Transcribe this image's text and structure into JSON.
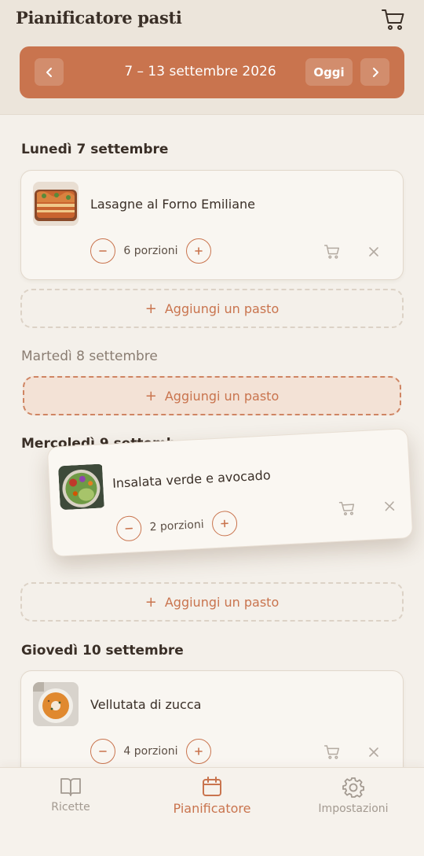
{
  "header": {
    "title": "Pianificatore pasti",
    "cart_icon": "shopping-cart-icon"
  },
  "week_nav": {
    "prev_icon": "chevron-left-icon",
    "range": "7 – 13 settembre 2026",
    "today_label": "Oggi",
    "next_icon": "chevron-right-icon"
  },
  "days": [
    {
      "title": "Lunedì 7 settembre",
      "meals": [
        {
          "name": "Lasagne al Forno Emiliane",
          "portions": "6 porzioni"
        }
      ],
      "add_label": "Aggiungi un pasto"
    },
    {
      "title": "Martedì 8 settembre",
      "meals": [],
      "add_label": "Aggiungi un pasto"
    },
    {
      "title": "Mercoledì 9 settembre",
      "meals": [],
      "add_label": "Aggiungi un pasto"
    },
    {
      "title": "Giovedì 10 settembre",
      "meals": [
        {
          "name": "Vellutata di zucca",
          "portions": "4 porzioni"
        }
      ],
      "add_label": "Aggiungi un pasto"
    }
  ],
  "dragged_meal": {
    "name": "Insalata verde e avocado",
    "portions": "2 porzioni"
  },
  "nav": [
    {
      "label": "Ricette",
      "icon": "book-icon",
      "active": false
    },
    {
      "label": "Pianificatore",
      "icon": "calendar-icon",
      "active": true
    },
    {
      "label": "Impostazioni",
      "icon": "gear-icon",
      "active": false
    }
  ],
  "colors": {
    "accent": "#c9744e",
    "background": "#f4f0ea",
    "header": "#ece5db",
    "text": "#3a2f27",
    "muted": "#8a7d72"
  }
}
